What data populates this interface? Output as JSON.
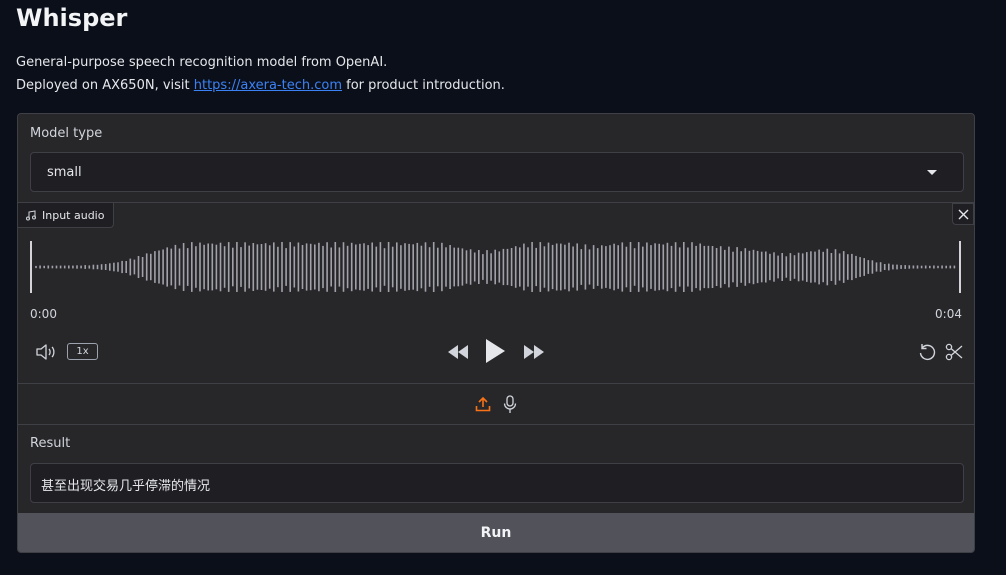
{
  "header": {
    "title": "Whisper",
    "description_line1": "General-purpose speech recognition model from OpenAI.",
    "description_line2_pre": "Deployed on AX650N, visit ",
    "link_text": "https://axera-tech.com",
    "description_line2_post": " for product introduction."
  },
  "model": {
    "label": "Model type",
    "selected": "small"
  },
  "audio": {
    "label": "Input audio",
    "time_start": "0:00",
    "time_end": "0:04",
    "speed": "1x",
    "icons": [
      "music-note-icon",
      "close-icon",
      "volume-icon",
      "rewind-icon",
      "play-icon",
      "fast-forward-icon",
      "undo-icon",
      "scissors-icon",
      "upload-icon",
      "microphone-icon"
    ],
    "accent_color": "#f97316"
  },
  "result": {
    "label": "Result",
    "value": "甚至出现交易几乎停滞的情况"
  },
  "actions": {
    "run_label": "Run"
  }
}
